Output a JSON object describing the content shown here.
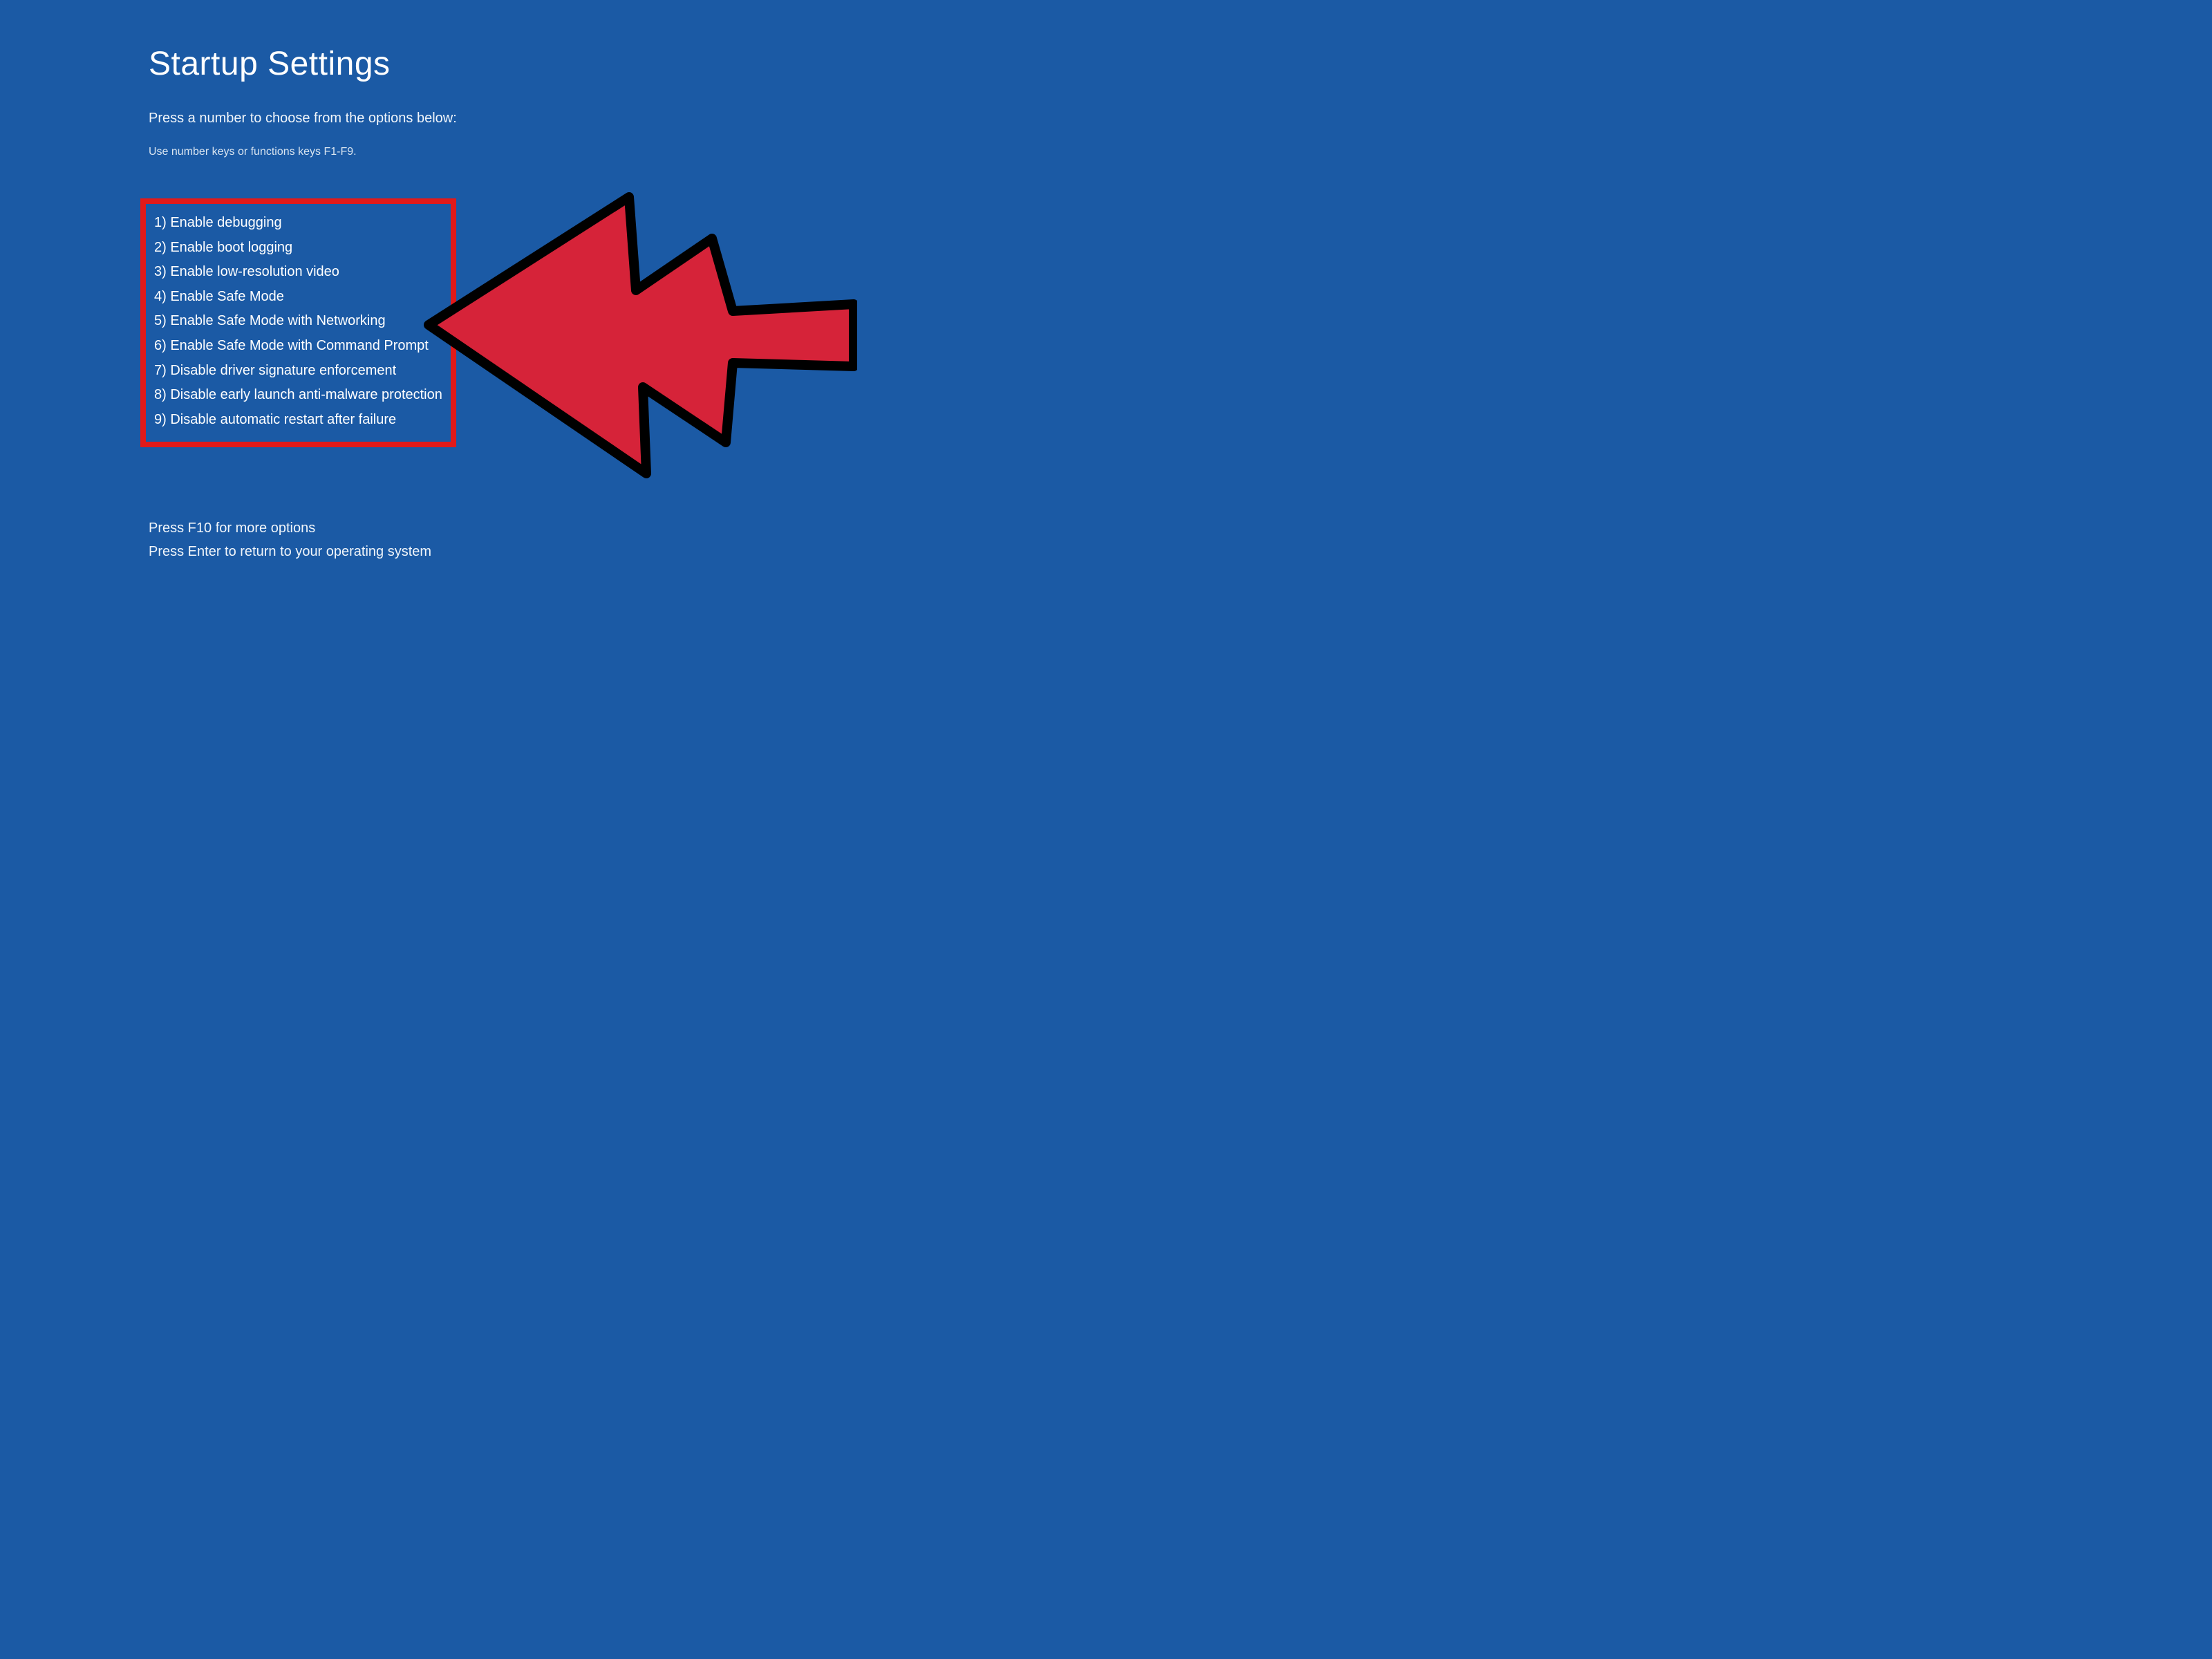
{
  "title": "Startup Settings",
  "subtitle": "Press a number to choose from the options below:",
  "hint": "Use number keys or functions keys F1-F9.",
  "options": [
    "1) Enable debugging",
    "2) Enable boot logging",
    "3) Enable low-resolution video",
    "4) Enable Safe Mode",
    "5) Enable Safe Mode with Networking",
    "6) Enable Safe Mode with Command Prompt",
    "7) Disable driver signature enforcement",
    "8) Disable early launch anti-malware protection",
    "9) Disable automatic restart after failure"
  ],
  "footer": {
    "line1": "Press F10 for more options",
    "line2": "Press Enter to return to your operating system"
  },
  "annotation": {
    "highlight_color": "#e11a1a",
    "arrow_fill": "#d62339",
    "arrow_stroke": "#000000"
  }
}
